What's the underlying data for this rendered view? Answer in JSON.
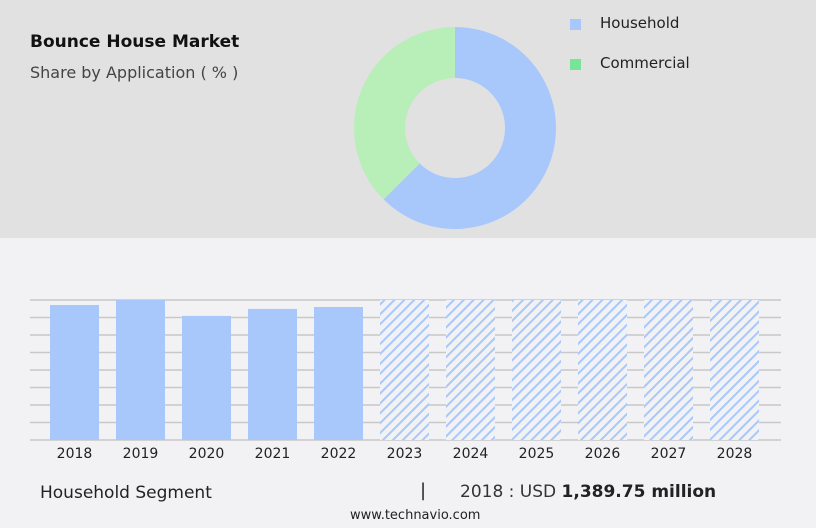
{
  "header": {
    "title": "Bounce House Market",
    "subtitle": "Share by Application ( % )"
  },
  "colors": {
    "household": "#a8c8fc",
    "commercial_slice": "#b8eeb8",
    "commercial_legend": "#78e498",
    "forecast_hatch": "#a8c8fc"
  },
  "chart_data": [
    {
      "type": "pie",
      "donut": true,
      "title": "Bounce House Market",
      "subtitle": "Share by Application ( % )",
      "legend": "top-right",
      "slices": [
        {
          "name": "Household",
          "value": 62.5
        },
        {
          "name": "Commercial",
          "value": 37.5
        }
      ]
    },
    {
      "type": "bar",
      "categories": [
        "2018",
        "2019",
        "2020",
        "2021",
        "2022",
        "2023",
        "2024",
        "2025",
        "2026",
        "2027",
        "2028"
      ],
      "values": [
        1389.75,
        1441,
        1277,
        1349,
        1369,
        1441,
        1441,
        1441,
        1441,
        1441,
        1441
      ],
      "forecast_from": "2023",
      "grid": true,
      "ylim": [
        0,
        1441
      ]
    }
  ],
  "footer": {
    "segment": "Household Segment",
    "separator": "|",
    "year_label": "2018 : USD",
    "value": "1,389.75 million",
    "url": "www.technavio.com"
  }
}
